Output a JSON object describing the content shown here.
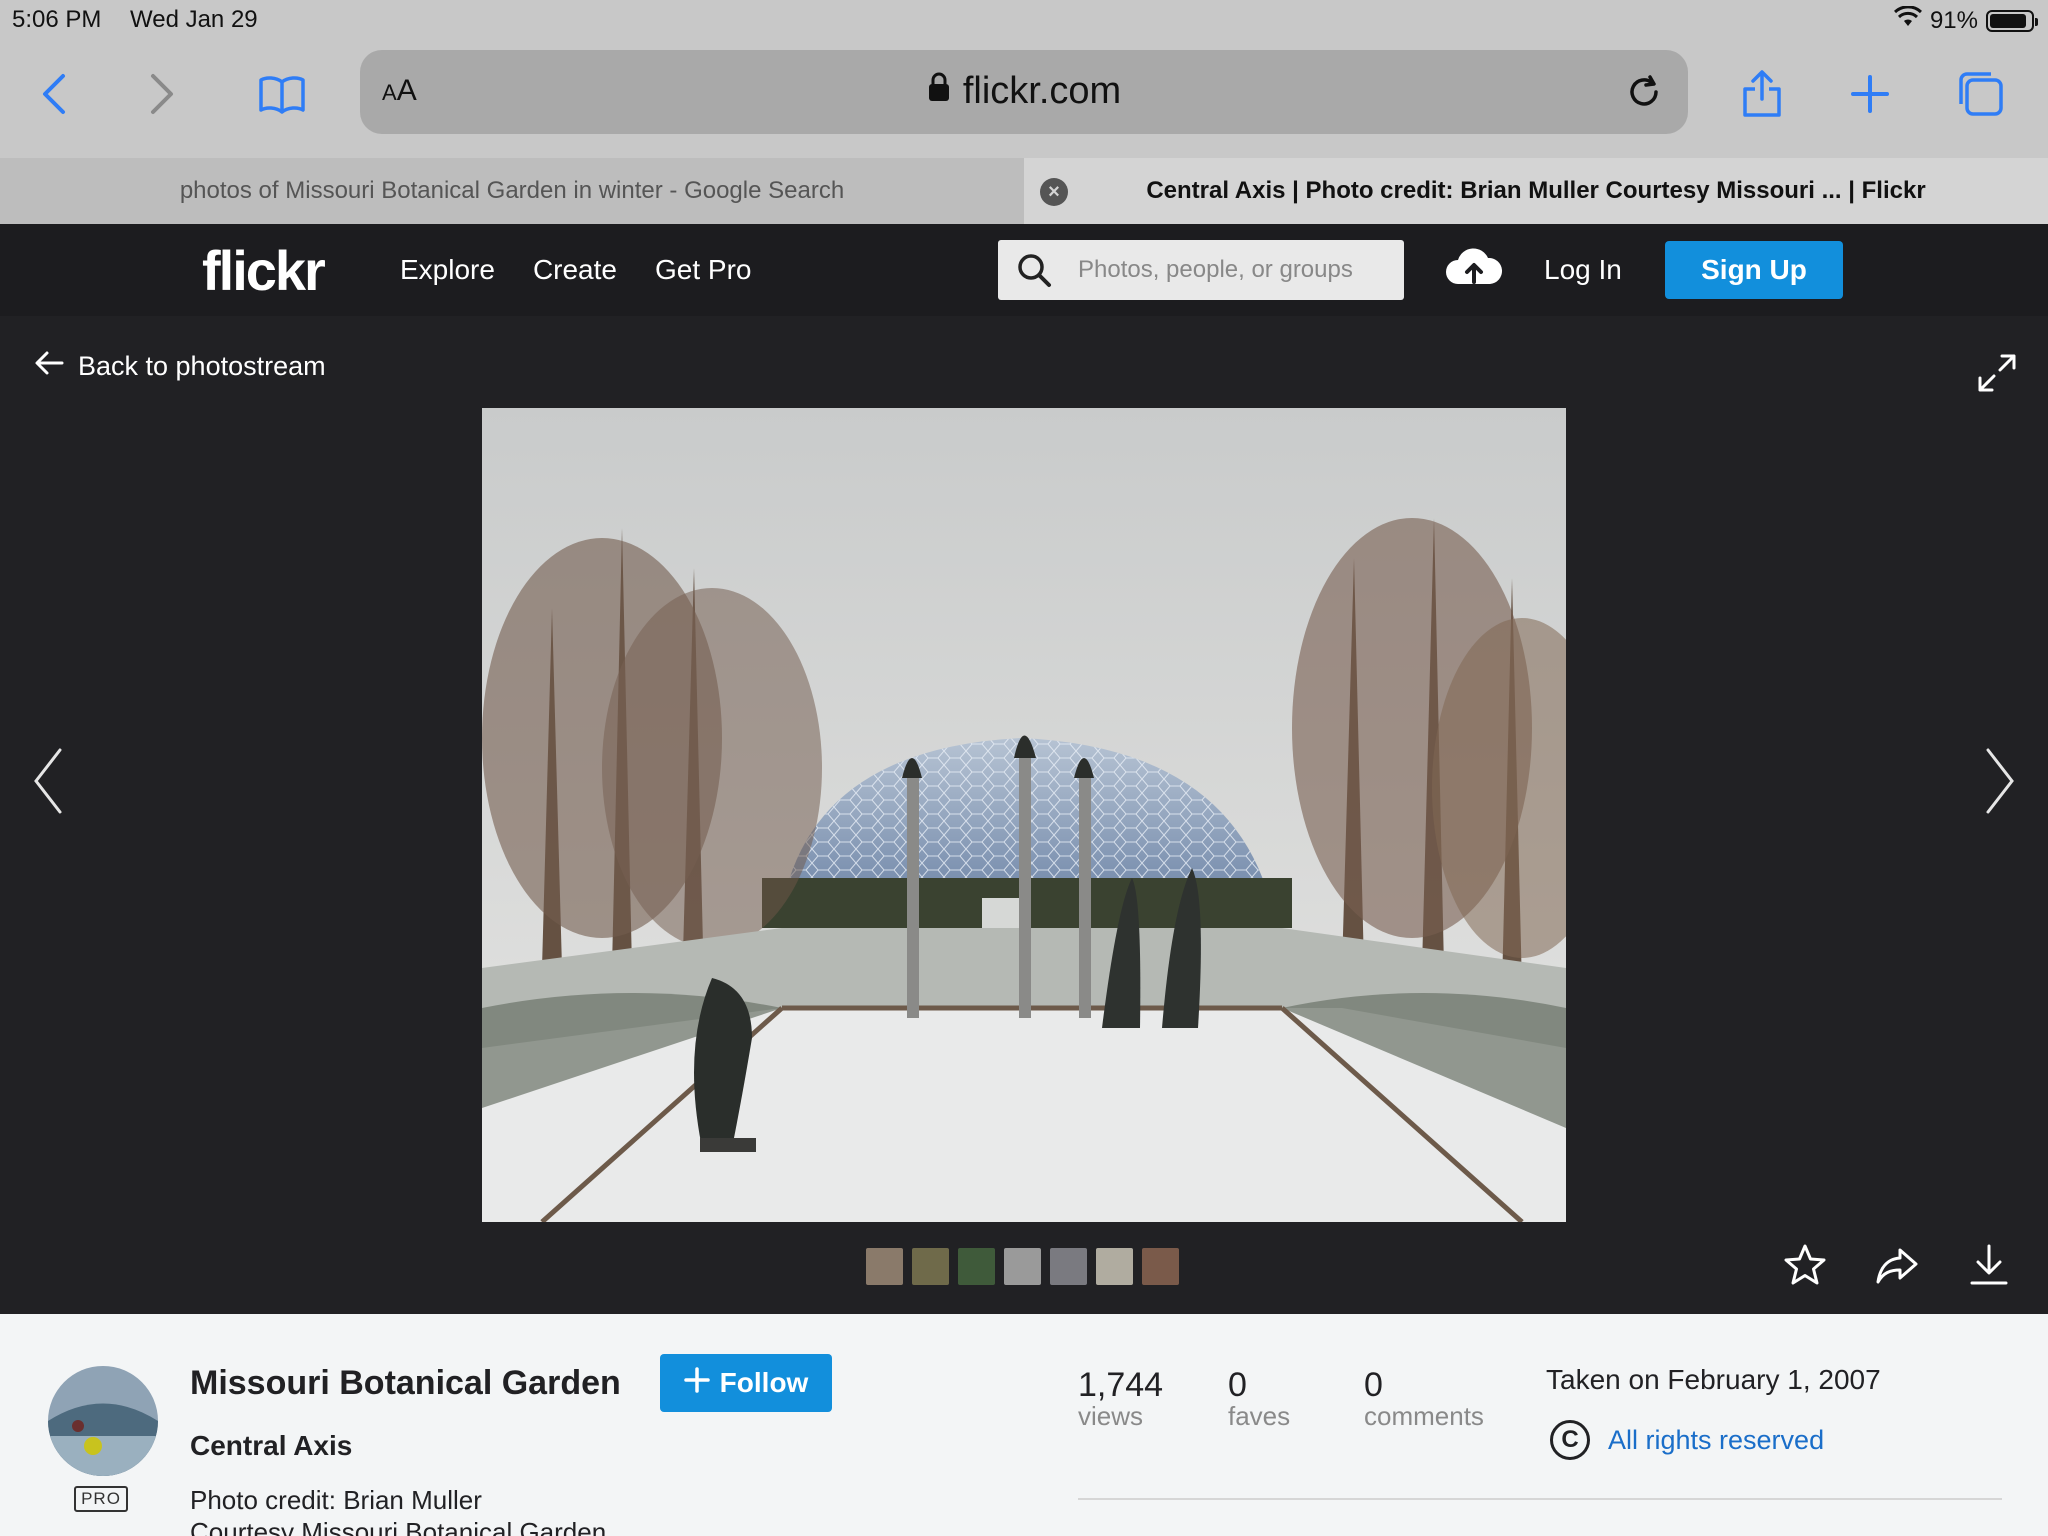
{
  "status_bar": {
    "time": "5:06 PM",
    "date": "Wed Jan 29",
    "battery": "91%",
    "battery_level": 0.91
  },
  "browser": {
    "reader_label": "AA",
    "url": "flickr.com",
    "tabs": [
      {
        "title": "photos of Missouri Botanical Garden in winter - Google Search",
        "active": false
      },
      {
        "title": "Central Axis | Photo credit: Brian Muller Courtesy Missouri ... | Flickr",
        "active": true
      }
    ]
  },
  "nav": {
    "logo": "flickr",
    "links": [
      "Explore",
      "Create",
      "Get Pro"
    ],
    "search_placeholder": "Photos, people, or groups",
    "login": "Log In",
    "signup": "Sign Up"
  },
  "photo_view": {
    "back_label": "Back to photostream",
    "thumbnail_colors": [
      "#8a7a6a",
      "#6f6a4a",
      "#3f5a3a",
      "#9a9a9a",
      "#7a7a80",
      "#b0aca0",
      "#7a5a4a"
    ]
  },
  "info": {
    "owner": "Missouri Botanical Garden",
    "pro_badge": "PRO",
    "follow_label": "Follow",
    "title": "Central Axis",
    "description_lines": [
      "Photo credit: Brian Muller",
      "Courtesy Missouri Botanical Garden"
    ],
    "stats": [
      {
        "value": "1,744",
        "label": "views"
      },
      {
        "value": "0",
        "label": "faves"
      },
      {
        "value": "0",
        "label": "comments"
      }
    ],
    "taken": "Taken on February 1, 2007",
    "rights": "All rights reserved"
  },
  "colors": {
    "accent": "#128fdc",
    "nav_bg": "#1c1c1f",
    "stage_bg": "#212124",
    "link": "#1a6ec9"
  }
}
